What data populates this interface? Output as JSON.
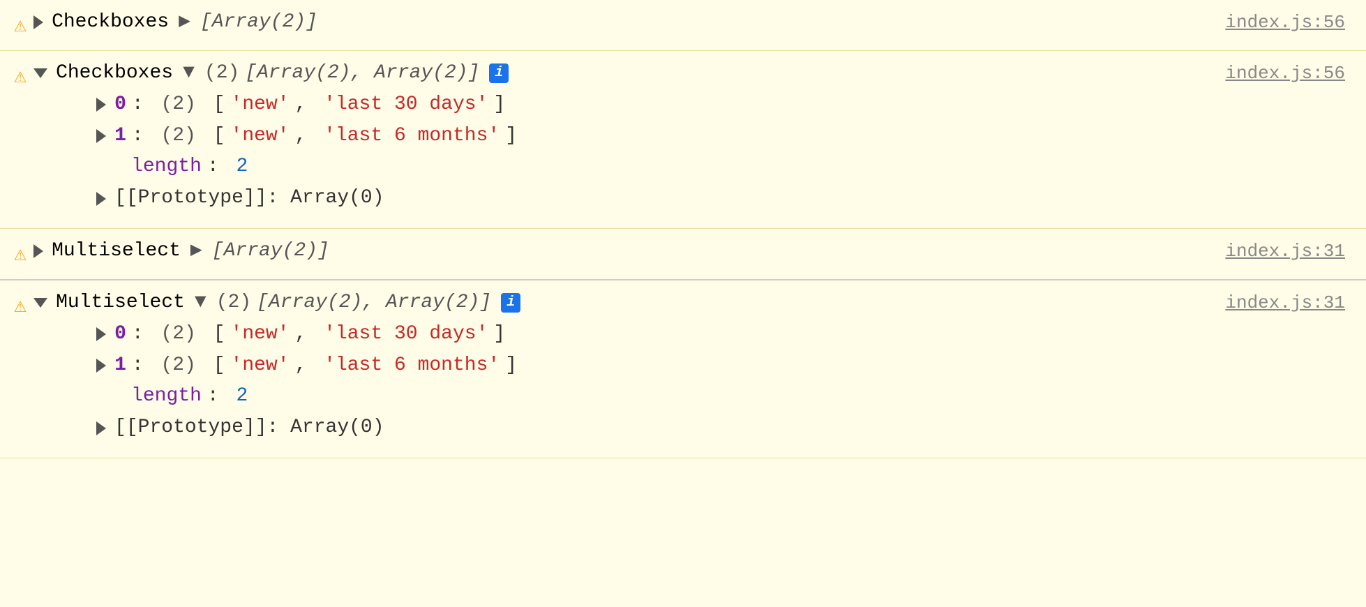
{
  "entries": [
    {
      "id": "entry1",
      "warning": true,
      "expanded": false,
      "label": "Checkboxes",
      "arrow": "right",
      "value_italic": "[Array(2)]",
      "file": "index.js:56"
    },
    {
      "id": "entry2",
      "warning": true,
      "expanded": true,
      "label": "Checkboxes",
      "arrow": "down",
      "value_count": "(2)",
      "value_italic": "[Array(2), Array(2)]",
      "info": true,
      "file": "index.js:56",
      "children": [
        {
          "type": "array-item",
          "index": "0",
          "count": "(2)",
          "items": [
            "'new'",
            "'last 30 days'"
          ]
        },
        {
          "type": "array-item",
          "index": "1",
          "count": "(2)",
          "items": [
            "'new'",
            "'last 6 months'"
          ]
        },
        {
          "type": "length",
          "key": "length",
          "value": "2"
        },
        {
          "type": "prototype",
          "text": "[[Prototype]]: Array(0)"
        }
      ]
    },
    {
      "id": "entry3",
      "warning": true,
      "expanded": false,
      "label": "Multiselect",
      "arrow": "right",
      "value_italic": "[Array(2)]",
      "file": "index.js:31",
      "separator": true
    },
    {
      "id": "entry4",
      "warning": true,
      "expanded": true,
      "label": "Multiselect",
      "arrow": "down",
      "value_count": "(2)",
      "value_italic": "[Array(2), Array(2)]",
      "info": true,
      "file": "index.js:31",
      "children": [
        {
          "type": "array-item",
          "index": "0",
          "count": "(2)",
          "items": [
            "'new'",
            "'last 30 days'"
          ]
        },
        {
          "type": "array-item",
          "index": "1",
          "count": "(2)",
          "items": [
            "'new'",
            "'last 6 months'"
          ]
        },
        {
          "type": "length",
          "key": "length",
          "value": "2"
        },
        {
          "type": "prototype",
          "text": "[[Prototype]]: Array(0)"
        }
      ]
    }
  ]
}
